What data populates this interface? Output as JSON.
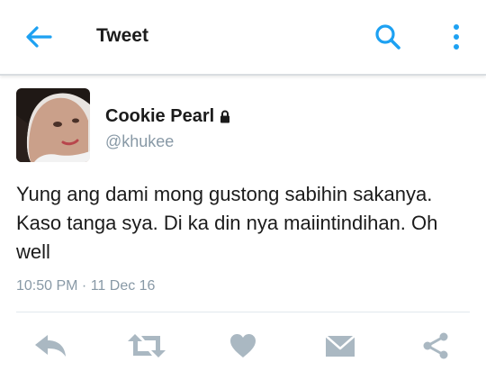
{
  "header": {
    "title": "Tweet",
    "back_icon": "arrow-left-icon",
    "search_icon": "search-icon",
    "more_icon": "more-vertical-icon"
  },
  "tweet": {
    "author": {
      "display_name": "Cookie Pearl",
      "handle": "@khukee",
      "protected_icon": "lock-icon"
    },
    "text": "Yung ang dami mong gustong sabihin sakanya. Kaso tanga sya. Di ka din nya maiintindihan. Oh well",
    "timestamp": "10:50 PM · 11 Dec 16"
  },
  "actions": [
    {
      "name": "reply",
      "icon": "reply-icon"
    },
    {
      "name": "retweet",
      "icon": "retweet-icon"
    },
    {
      "name": "like",
      "icon": "heart-icon"
    },
    {
      "name": "direct-message",
      "icon": "envelope-icon"
    },
    {
      "name": "share",
      "icon": "share-icon"
    }
  ],
  "colors": {
    "accent": "#1da1f2",
    "action_icon": "#aab8c2",
    "secondary_text": "#8899a6"
  }
}
